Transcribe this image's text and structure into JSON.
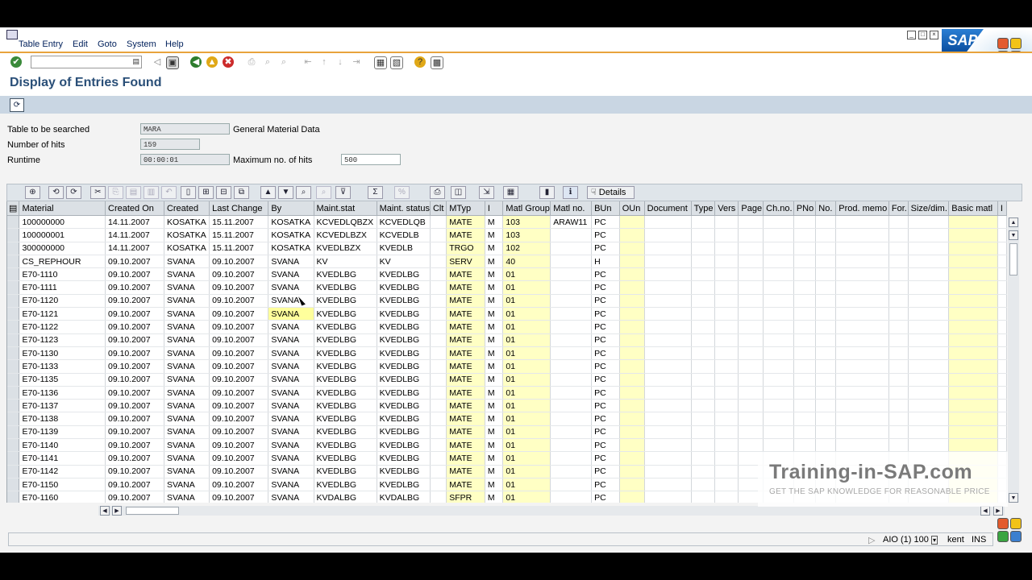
{
  "menu": [
    "Table Entry",
    "Edit",
    "Goto",
    "System",
    "Help"
  ],
  "brand": {
    "logo": "SAP"
  },
  "toolbar_icons": [
    "enter-icon",
    "back-icon",
    "exit-icon",
    "cancel-icon",
    "save-icon",
    "print-icon",
    "find-icon",
    "find-next-icon",
    "first-page-icon",
    "previous-page-icon",
    "next-page-icon",
    "last-page-icon",
    "create-session-icon",
    "shortcut-icon",
    "help-icon",
    "customize-layout-icon"
  ],
  "page": {
    "title": "Display of Entries Found"
  },
  "fields": {
    "table_label": "Table to be searched",
    "table_value": "MARA",
    "table_desc": "General Material Data",
    "hits_label": "Number of hits",
    "hits_value": "159",
    "runtime_label": "Runtime",
    "runtime_value": "00:00:01",
    "maxhits_label": "Maximum no. of hits",
    "maxhits_value": "500"
  },
  "alv_toolbar": {
    "details_label": "Details"
  },
  "grid": {
    "columns": [
      "Material",
      "Created On",
      "Created",
      "Last Change",
      "By",
      "Maint.stat",
      "Maint. status",
      "Clt",
      "MTyp",
      "I",
      "Matl Group",
      "Matl no.",
      "BUn",
      "OUn",
      "Document",
      "Type",
      "Vers",
      "Page",
      "Ch.no.",
      "PNo",
      "No.",
      "Prod. memo",
      "For.",
      "Size/dim.",
      "Basic matl",
      "I"
    ],
    "rows": [
      [
        "100000000",
        "14.11.2007",
        "KOSATKA",
        "15.11.2007",
        "KOSATKA",
        "KCVEDLQBZX",
        "KCVEDLQB",
        "",
        "MATE",
        "M",
        "103",
        "ARAW11",
        "PC"
      ],
      [
        "100000001",
        "14.11.2007",
        "KOSATKA",
        "15.11.2007",
        "KOSATKA",
        "KCVEDLBZX",
        "KCVEDLB",
        "",
        "MATE",
        "M",
        "103",
        "",
        "PC"
      ],
      [
        "300000000",
        "14.11.2007",
        "KOSATKA",
        "15.11.2007",
        "KOSATKA",
        "KVEDLBZX",
        "KVEDLB",
        "",
        "TRGO",
        "M",
        "102",
        "",
        "PC"
      ],
      [
        "CS_REPHOUR",
        "09.10.2007",
        "SVANA",
        "09.10.2007",
        "SVANA",
        "KV",
        "KV",
        "",
        "SERV",
        "M",
        "40",
        "",
        "H"
      ],
      [
        "E70-1110",
        "09.10.2007",
        "SVANA",
        "09.10.2007",
        "SVANA",
        "KVEDLBG",
        "KVEDLBG",
        "",
        "MATE",
        "M",
        "01",
        "",
        "PC"
      ],
      [
        "E70-1111",
        "09.10.2007",
        "SVANA",
        "09.10.2007",
        "SVANA",
        "KVEDLBG",
        "KVEDLBG",
        "",
        "MATE",
        "M",
        "01",
        "",
        "PC"
      ],
      [
        "E70-1120",
        "09.10.2007",
        "SVANA",
        "09.10.2007",
        "SVANA",
        "KVEDLBG",
        "KVEDLBG",
        "",
        "MATE",
        "M",
        "01",
        "",
        "PC"
      ],
      [
        "E70-1121",
        "09.10.2007",
        "SVANA",
        "09.10.2007",
        "SVANA",
        "KVEDLBG",
        "KVEDLBG",
        "",
        "MATE",
        "M",
        "01",
        "",
        "PC"
      ],
      [
        "E70-1122",
        "09.10.2007",
        "SVANA",
        "09.10.2007",
        "SVANA",
        "KVEDLBG",
        "KVEDLBG",
        "",
        "MATE",
        "M",
        "01",
        "",
        "PC"
      ],
      [
        "E70-1123",
        "09.10.2007",
        "SVANA",
        "09.10.2007",
        "SVANA",
        "KVEDLBG",
        "KVEDLBG",
        "",
        "MATE",
        "M",
        "01",
        "",
        "PC"
      ],
      [
        "E70-1130",
        "09.10.2007",
        "SVANA",
        "09.10.2007",
        "SVANA",
        "KVEDLBG",
        "KVEDLBG",
        "",
        "MATE",
        "M",
        "01",
        "",
        "PC"
      ],
      [
        "E70-1133",
        "09.10.2007",
        "SVANA",
        "09.10.2007",
        "SVANA",
        "KVEDLBG",
        "KVEDLBG",
        "",
        "MATE",
        "M",
        "01",
        "",
        "PC"
      ],
      [
        "E70-1135",
        "09.10.2007",
        "SVANA",
        "09.10.2007",
        "SVANA",
        "KVEDLBG",
        "KVEDLBG",
        "",
        "MATE",
        "M",
        "01",
        "",
        "PC"
      ],
      [
        "E70-1136",
        "09.10.2007",
        "SVANA",
        "09.10.2007",
        "SVANA",
        "KVEDLBG",
        "KVEDLBG",
        "",
        "MATE",
        "M",
        "01",
        "",
        "PC"
      ],
      [
        "E70-1137",
        "09.10.2007",
        "SVANA",
        "09.10.2007",
        "SVANA",
        "KVEDLBG",
        "KVEDLBG",
        "",
        "MATE",
        "M",
        "01",
        "",
        "PC"
      ],
      [
        "E70-1138",
        "09.10.2007",
        "SVANA",
        "09.10.2007",
        "SVANA",
        "KVEDLBG",
        "KVEDLBG",
        "",
        "MATE",
        "M",
        "01",
        "",
        "PC"
      ],
      [
        "E70-1139",
        "09.10.2007",
        "SVANA",
        "09.10.2007",
        "SVANA",
        "KVEDLBG",
        "KVEDLBG",
        "",
        "MATE",
        "M",
        "01",
        "",
        "PC"
      ],
      [
        "E70-1140",
        "09.10.2007",
        "SVANA",
        "09.10.2007",
        "SVANA",
        "KVEDLBG",
        "KVEDLBG",
        "",
        "MATE",
        "M",
        "01",
        "",
        "PC"
      ],
      [
        "E70-1141",
        "09.10.2007",
        "SVANA",
        "09.10.2007",
        "SVANA",
        "KVEDLBG",
        "KVEDLBG",
        "",
        "MATE",
        "M",
        "01",
        "",
        "PC"
      ],
      [
        "E70-1142",
        "09.10.2007",
        "SVANA",
        "09.10.2007",
        "SVANA",
        "KVEDLBG",
        "KVEDLBG",
        "",
        "MATE",
        "M",
        "01",
        "",
        "PC"
      ],
      [
        "E70-1150",
        "09.10.2007",
        "SVANA",
        "09.10.2007",
        "SVANA",
        "KVEDLBG",
        "KVEDLBG",
        "",
        "MATE",
        "M",
        "01",
        "",
        "PC"
      ],
      [
        "E70-1160",
        "09.10.2007",
        "SVANA",
        "09.10.2007",
        "SVANA",
        "KVDALBG",
        "KVDALBG",
        "",
        "SFPR",
        "M",
        "01",
        "",
        "PC"
      ]
    ],
    "selected_cell": {
      "row": 7,
      "col": 4
    }
  },
  "watermark": {
    "title": "Training-in-SAP.com",
    "subtitle": "GET THE SAP KNOWLEDGE FOR REASONABLE PRICE"
  },
  "status": {
    "system": "AIO (1) 100",
    "server": "kent",
    "mode": "INS"
  },
  "colors": {
    "accent": "#e8a33c",
    "header_blue": "#2a4f78",
    "highlight_yellow": "#ffffc4",
    "app_bar": "#c9d6e3"
  }
}
